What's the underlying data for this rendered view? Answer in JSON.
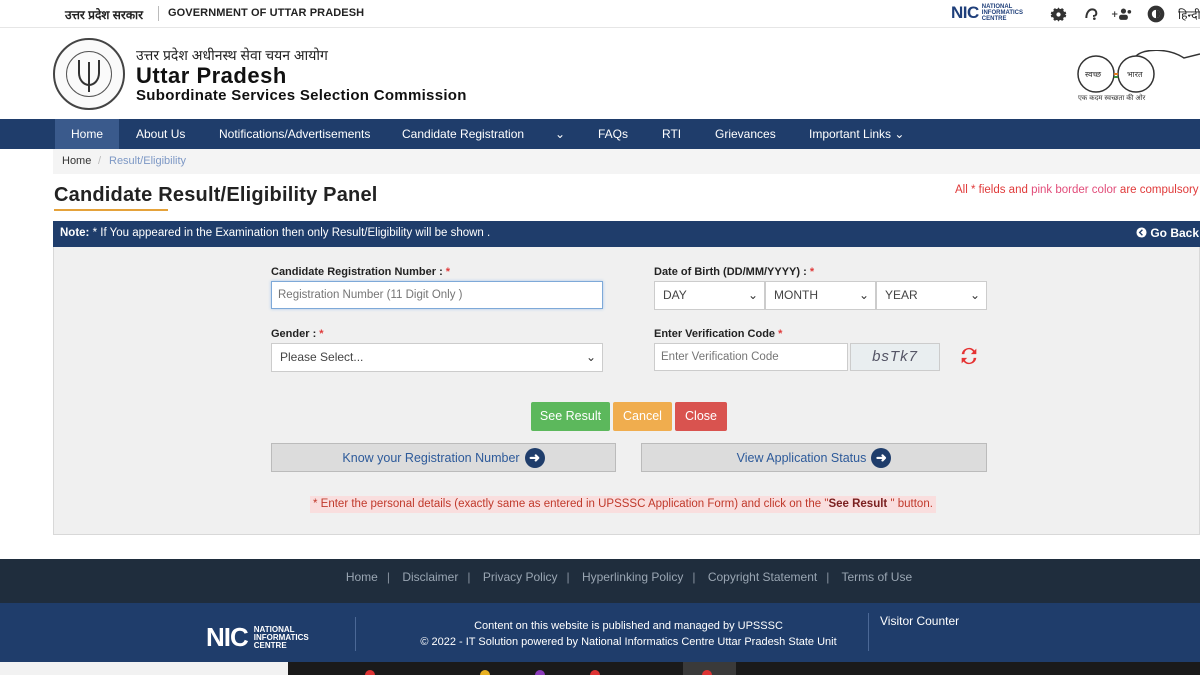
{
  "topbar": {
    "gov_hindi": "उत्तर प्रदेश सरकार",
    "gov_english": "GOVERNMENT OF UTTAR PRADESH",
    "nic_logo_text": "NIC",
    "nic_logo_sub": "NATIONAL INFORMATICS CENTRE",
    "icons": [
      "settings-icon",
      "accessibility-audio-icon",
      "font-size-icon",
      "contrast-icon"
    ],
    "language": "हिन्दी"
  },
  "header": {
    "hindi_name": "उत्तर प्रदेश अधीनस्थ सेवा चयन आयोग",
    "title": "Uttar Pradesh",
    "subtitle": "Subordinate Services Selection Commission",
    "swachh_left": "स्वच्छ",
    "swachh_right": "भारत",
    "swachh_tagline": "एक कदम स्वच्छता की ओर"
  },
  "nav": {
    "items": [
      {
        "label": "Home",
        "active": true
      },
      {
        "label": "About Us"
      },
      {
        "label": "Notifications/Advertisements"
      },
      {
        "label": "Candidate Registration"
      },
      {
        "label": "FAQs"
      },
      {
        "label": "RTI"
      },
      {
        "label": "Grievances"
      },
      {
        "label": "Important Links ⌄"
      }
    ],
    "dropdown_chevron": "⌄"
  },
  "breadcrumb": {
    "home": "Home",
    "separator": "/",
    "current": "Result/Eligibility"
  },
  "panel": {
    "title": "Candidate Result/Eligibility Panel",
    "required_note_prefix": "All * fields and ",
    "required_note_pink": "pink border color",
    "required_note_suffix": " are compulsory",
    "notice_bold": "Note:",
    "notice_text": " * If You appeared in the Examination then only Result/Eligibility will be shown .",
    "go_back": "Go Back"
  },
  "form": {
    "reg_label": "Candidate Registration Number : ",
    "reg_placeholder": "Registration Number (11 Digit Only )",
    "dob_label": "Date of Birth (DD/MM/YYYY) : ",
    "day": "DAY",
    "month": "MONTH",
    "year": "YEAR",
    "gender_label": "Gender : ",
    "gender_value": "Please Select...",
    "verify_label": "Enter Verification Code ",
    "verify_placeholder": "Enter Verification Code",
    "captcha": "bsTk7",
    "star": "*"
  },
  "buttons": {
    "see_result": "See Result",
    "cancel": "Cancel",
    "close": "Close",
    "know_reg": "Know your Registration Number",
    "view_status": "View Application Status"
  },
  "hint": {
    "prefix": "* Enter the personal details (exactly same as entered in UPSSSC Application Form) and click on the \"",
    "bold": "See Result",
    "suffix": " \" button."
  },
  "footer": {
    "links": [
      "Home",
      "Disclaimer",
      "Privacy Policy",
      "Hyperlinking Policy",
      "Copyright Statement",
      "Terms of Use"
    ],
    "separator": "|",
    "content_line": "Content on this website is published and managed by UPSSSC",
    "copyright_line": "© 2022 - IT Solution powered by National Informatics Centre Uttar Pradesh State Unit",
    "visitor_counter": "Visitor Counter",
    "nic_text": "NIC",
    "nic_sub1": "NATIONAL",
    "nic_sub2": "INFORMATICS",
    "nic_sub3": "CENTRE"
  },
  "colors": {
    "nav_bg": "#1f3d6b",
    "accent_underline": "#e5a23a",
    "required_red": "#e03a3a",
    "btn_green": "#5cb85c",
    "btn_orange": "#f0ad4e",
    "btn_red": "#d9534f"
  }
}
